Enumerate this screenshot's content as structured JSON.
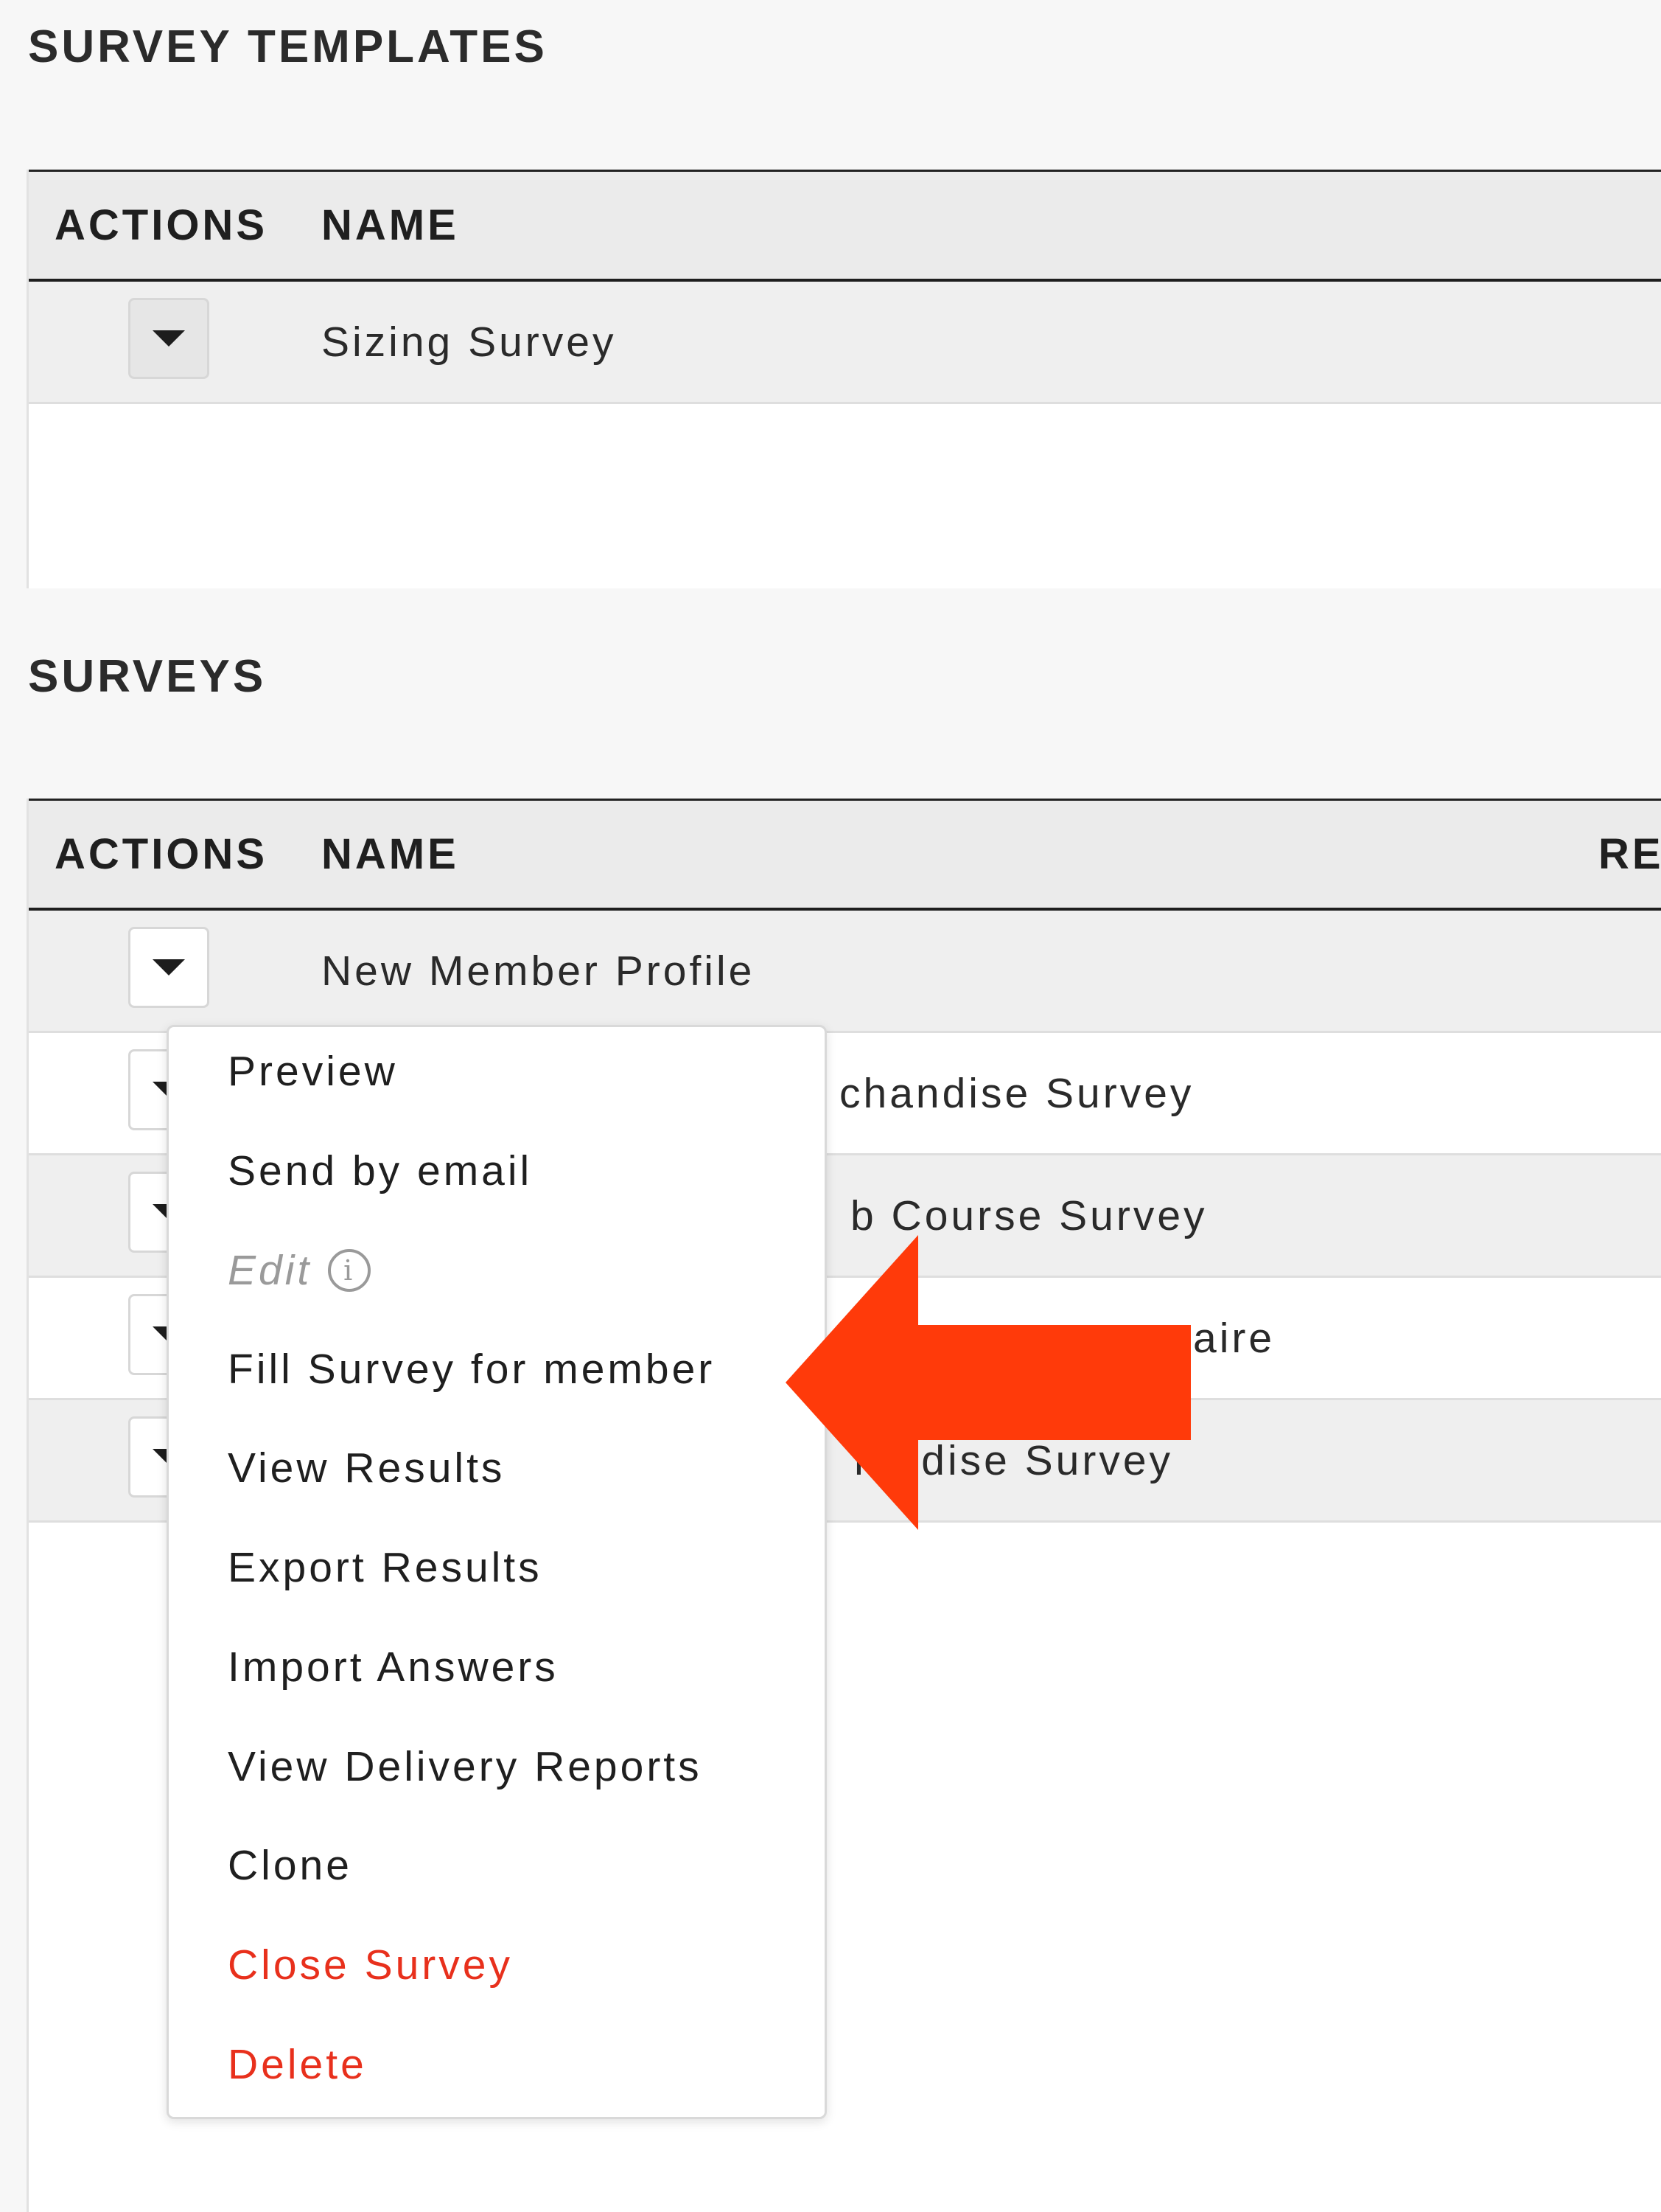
{
  "templates": {
    "title": "SURVEY TEMPLATES",
    "columns": {
      "actions": "ACTIONS",
      "name": "NAME"
    },
    "rows": [
      {
        "name": "Sizing Survey"
      }
    ]
  },
  "surveys": {
    "title": "SURVEYS",
    "columns": {
      "actions": "ACTIONS",
      "name": "NAME",
      "right": "RE"
    },
    "rows": [
      {
        "name": "New Member Profile"
      },
      {
        "name": "chandise Survey"
      },
      {
        "name": "b Course Survey"
      },
      {
        "name": "aire"
      },
      {
        "name": "ha dise Survey"
      }
    ]
  },
  "menu": {
    "items": [
      {
        "label": "Preview",
        "state": "normal"
      },
      {
        "label": "Send by email",
        "state": "normal"
      },
      {
        "label": "Edit",
        "state": "disabled"
      },
      {
        "label": "Fill Survey for member",
        "state": "normal"
      },
      {
        "label": "View Results",
        "state": "normal"
      },
      {
        "label": "Export Results",
        "state": "normal"
      },
      {
        "label": "Import Answers",
        "state": "normal"
      },
      {
        "label": "View Delivery Reports",
        "state": "normal"
      },
      {
        "label": "Clone",
        "state": "normal"
      },
      {
        "label": "Close Survey",
        "state": "danger"
      },
      {
        "label": "Delete",
        "state": "danger"
      }
    ]
  },
  "colors": {
    "danger": "#e8301c",
    "annotation_arrow": "#ff3a0a",
    "header_bg": "#ebebeb",
    "row_shaded": "#efefef"
  },
  "icons": {
    "row_toggle": "caret-down-icon",
    "edit_info": "info-icon",
    "annotation": "left-arrow-annotation-icon"
  }
}
